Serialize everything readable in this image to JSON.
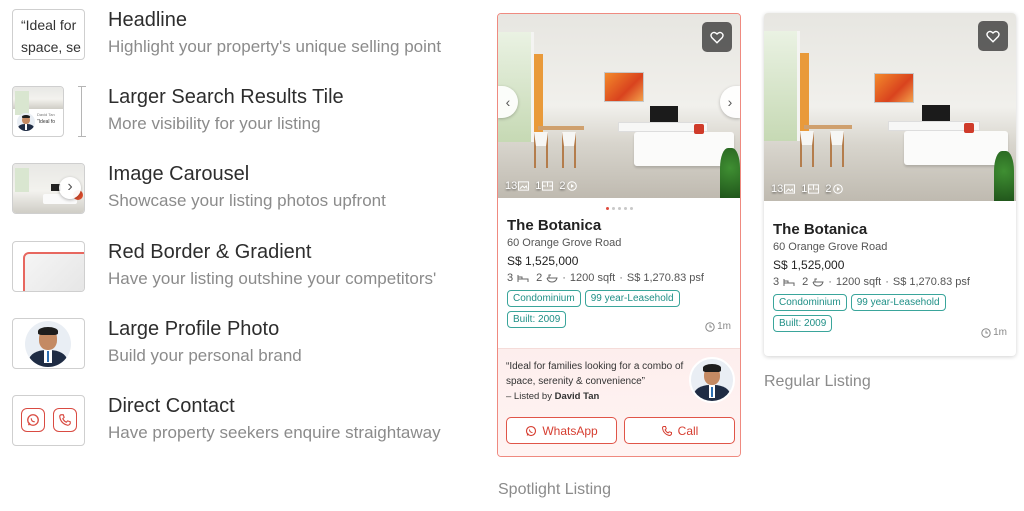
{
  "features": [
    {
      "title": "Headline",
      "subtitle": "Highlight your property's unique selling point",
      "thumb_text_1": "“Ideal for",
      "thumb_text_2": "space, se"
    },
    {
      "title": "Larger Search Results Tile",
      "subtitle": "More visibility for your listing",
      "thumb_text_1": "David Tan",
      "thumb_text_2": "“Ideal fo"
    },
    {
      "title": "Image Carousel",
      "subtitle": "Showcase your listing photos upfront"
    },
    {
      "title": "Red Border & Gradient",
      "subtitle": "Have your listing outshine your competitors'"
    },
    {
      "title": "Large Profile Photo",
      "subtitle": "Build your personal brand"
    },
    {
      "title": "Direct Contact",
      "subtitle": "Have property seekers enquire straightaway"
    }
  ],
  "listing": {
    "name": "The Botanica",
    "address": "60 Orange Grove Road",
    "price": "S$ 1,525,000",
    "beds": "3",
    "baths": "2",
    "area": "1200 sqft",
    "psf": "S$ 1,270.83 psf",
    "tags": [
      "Condominium",
      "99 year-Leasehold",
      "Built: 2009"
    ],
    "time": "1m",
    "photo_count": "13",
    "floorplan_count": "1",
    "video_count": "2",
    "carousel_dots": 5
  },
  "spotlight": {
    "quote": "“Ideal for families looking for a combo of space, serenity & convenience”",
    "listed_prefix": "– Listed by",
    "agent_name": "David Tan",
    "whatsapp_label": "WhatsApp",
    "call_label": "Call"
  },
  "captions": {
    "spotlight": "Spotlight Listing",
    "regular": "Regular Listing"
  },
  "colors": {
    "accent_red": "#e05548",
    "tag_teal": "#3aa59b",
    "border_red": "#ef8a80"
  }
}
